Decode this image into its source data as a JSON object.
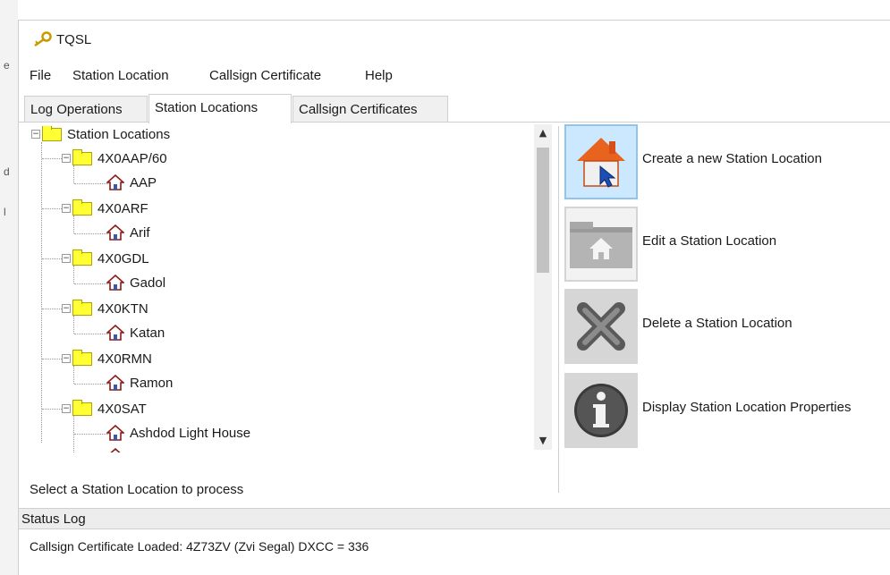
{
  "window": {
    "title": "TQSL"
  },
  "menu": [
    "File",
    "Station Location",
    "Callsign Certificate",
    "Help"
  ],
  "tabs": [
    {
      "label": "Log Operations",
      "active": false
    },
    {
      "label": "Station Locations",
      "active": true
    },
    {
      "label": "Callsign Certificates",
      "active": false
    }
  ],
  "tree": {
    "root": "Station Locations",
    "groups": [
      {
        "callsign": "4X0AAP/60",
        "locations": [
          "AAP"
        ]
      },
      {
        "callsign": "4X0ARF",
        "locations": [
          "Arif"
        ]
      },
      {
        "callsign": "4X0GDL",
        "locations": [
          "Gadol"
        ]
      },
      {
        "callsign": "4X0KTN",
        "locations": [
          "Katan"
        ]
      },
      {
        "callsign": "4X0RMN",
        "locations": [
          "Ramon"
        ]
      },
      {
        "callsign": "4X0SAT",
        "locations": [
          "Ashdod Light House"
        ]
      }
    ]
  },
  "hint": "Select a Station Location to process",
  "actions": [
    {
      "label": "Create a new Station Location",
      "icon": "house-cursor-icon"
    },
    {
      "label": "Edit a Station Location",
      "icon": "folder-house-icon"
    },
    {
      "label": "Delete a Station Location",
      "icon": "x-icon"
    },
    {
      "label": "Display Station Location Properties",
      "icon": "info-icon"
    }
  ],
  "status": {
    "header": "Status Log",
    "message": "Callsign Certificate Loaded:  4Z73ZV (Zvi Segal)  DXCC = 336"
  }
}
